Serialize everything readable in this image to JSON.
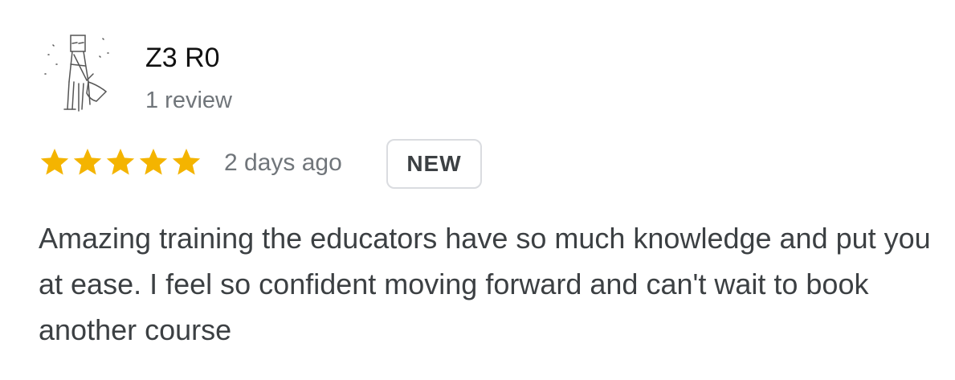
{
  "review": {
    "reviewer_name": "Z3 R0",
    "review_count": "1 review",
    "rating": 5,
    "rating_max": 5,
    "date": "2 days ago",
    "badge": "NEW",
    "text": "Amazing training the educators have so much knowledge and put you at ease. I feel so confident moving forward and can't wait to book another course"
  },
  "colors": {
    "star": "#F4B400",
    "badge_border": "#DADCE0",
    "secondary_text": "#70757A",
    "body_text": "#3C4043"
  },
  "icons": {
    "avatar": "sketch-figure-avatar",
    "star": "star-icon"
  }
}
